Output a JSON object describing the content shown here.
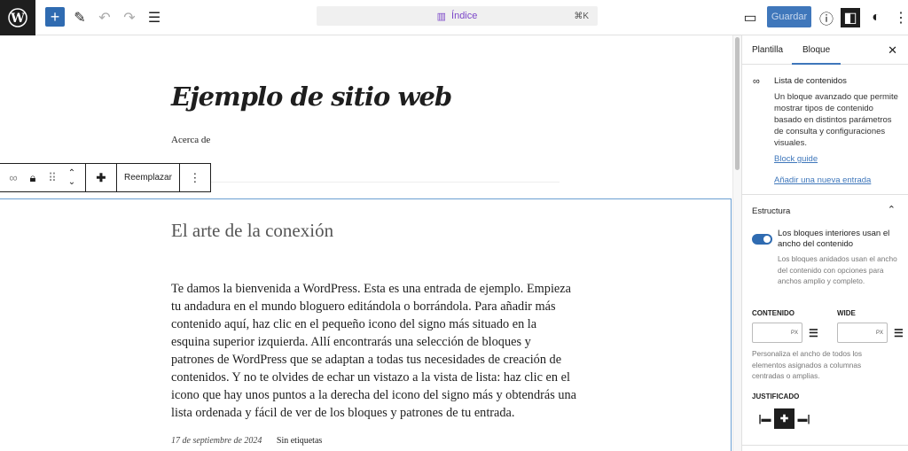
{
  "topbar": {
    "command": "Índice",
    "shortcut": "⌘K",
    "save": "Guardar"
  },
  "canvas": {
    "site_title": "Ejemplo de sitio web",
    "nav_item": "Acerca de",
    "toolbar": {
      "replace": "Reemplazar"
    },
    "post_title": "El arte de la conexión",
    "excerpt_lines": [
      "Te damos la bienvenida a WordPress. Esta es una entrada de ejemplo. Empieza",
      "tu andadura en el mundo bloguero editándola o borrándola. Para añadir más",
      "contenido aquí, haz clic en el pequeño icono del signo más situado en la",
      "esquina superior izquierda. Allí encontrarás una selección de bloques y",
      "patrones de WordPress que se adaptan a todas tus necesidades de creación de",
      "contenidos. Y no te olvides de echar un vistazo a la vista de lista: haz clic en el",
      "icono que hay unos puntos a la derecha del icono del signo más y obtendrás una",
      "lista ordenada y fácil de ver de los bloques y patrones de tu entrada."
    ],
    "date": "17 de septiembre de 2024",
    "tags": "Sin etiquetas"
  },
  "sidebar": {
    "tabs": [
      "Plantilla",
      "Bloque"
    ],
    "block_name": "Lista de contenidos",
    "block_desc": "Un bloque avanzado que permite mostrar tipos de contenido basado en distintos parámetros de consulta y configuraciones visuales.",
    "block_guide": "Block guide",
    "add_entry": "Añadir una nueva entrada",
    "panel_title": "Estructura",
    "toggle_label": "Los bloques interiores usan el ancho del contenido",
    "toggle_help": "Los bloques anidados usan el ancho del contenido con opciones para anchos amplio y completo.",
    "content_label": "CONTENIDO",
    "wide_label": "WIDE",
    "unit": "PX",
    "width_help": "Personaliza el ancho de todos los elementos asignados a columnas centradas o amplias.",
    "justify_label": "JUSTIFICADO"
  }
}
